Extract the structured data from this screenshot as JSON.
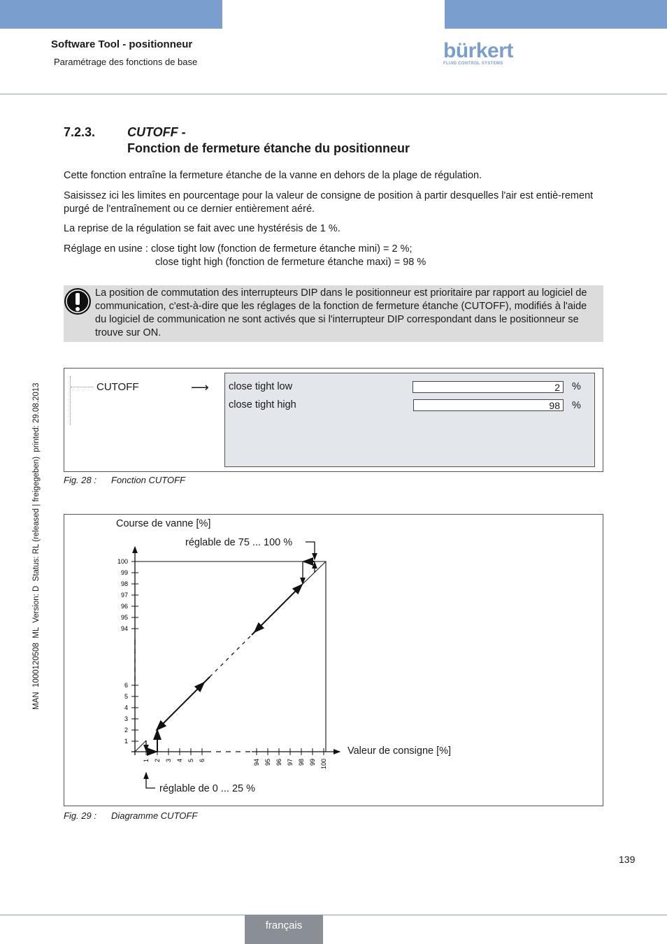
{
  "header": {
    "title": "Software Tool - positionneur",
    "subtitle": "Paramétrage des fonctions de base",
    "logo": "bürkert",
    "logo_tagline": "FLUID CONTROL SYSTEMS",
    "bar_color": "#7a9fcf"
  },
  "section": {
    "number": "7.2.3.",
    "title_italic": "CUTOFF -",
    "title": "Fonction de fermeture étanche du positionneur"
  },
  "paragraphs": [
    "Cette fonction entraîne la fermeture étanche de la vanne en dehors de la plage de régulation.",
    "Saisissez ici les limites en pourcentage pour la valeur de consigne de position à partir desquelles l'air est entiè-rement purgé de l'entraînement ou ce dernier entièrement aéré.",
    "La reprise de la régulation se fait avec une hystérésis de 1 %.",
    "Réglage en usine : close tight low (fonction de fermeture étanche mini) = 2 %;",
    "close tight high (fonction de fermeture étanche maxi) = 98 %"
  ],
  "note": {
    "icon": "exclamation-icon",
    "text": "La position de commutation des interrupteurs DIP dans le positionneur est prioritaire par rapport au logiciel de communication, c'est-à-dire que les réglages de la fonction de fermeture étanche (CUTOFF), modifiés à l'aide du logiciel de communication ne sont activés que si l'interrupteur DIP correspondant dans le positionneur se trouve sur ON."
  },
  "fig28": {
    "tree_item": "CUTOFF",
    "rows": [
      {
        "label": "close tight low",
        "value": "2",
        "unit": "%"
      },
      {
        "label": "close tight high",
        "value": "98",
        "unit": "%"
      }
    ],
    "caption_num": "Fig. 28 :",
    "caption": "Fonction CUTOFF"
  },
  "fig29": {
    "y_label": "Course de vanne [%]",
    "x_label": "Valeur de consigne [%]",
    "top_note": "réglable de 75 ... 100 %",
    "bottom_note": "réglable de 0 ... 25 %",
    "y_ticks_high": [
      "100",
      "99",
      "98",
      "97",
      "96",
      "95",
      "94"
    ],
    "y_ticks_low": [
      "6",
      "5",
      "4",
      "3",
      "2",
      "1"
    ],
    "x_ticks_low": [
      "1",
      "2",
      "3",
      "4",
      "5",
      "6"
    ],
    "x_ticks_high": [
      "94",
      "95",
      "96",
      "97",
      "98",
      "99",
      "100"
    ],
    "caption_num": "Fig. 29 :",
    "caption": "Diagramme CUTOFF"
  },
  "page_number": "139",
  "footer": {
    "language": "français"
  },
  "side_text": "MAN  1000120508  ML  Version: D  Status: RL (released | freigegeben)  printed: 29.08.2013"
}
